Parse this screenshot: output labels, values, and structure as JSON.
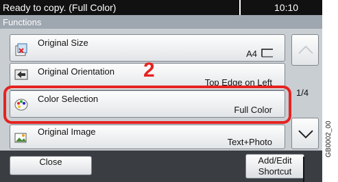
{
  "status": {
    "text": "Ready to copy. (Full Color)",
    "time": "10:10"
  },
  "header": {
    "title": "Functions"
  },
  "items": [
    {
      "label": "Original Size",
      "value": "A4",
      "icon": "original-size-icon"
    },
    {
      "label": "Original Orientation",
      "value": "Top Edge on Left",
      "icon": "orientation-icon"
    },
    {
      "label": "Color Selection",
      "value": "Full Color",
      "icon": "color-palette-icon"
    },
    {
      "label": "Original Image",
      "value": "Text+Photo",
      "icon": "image-quality-icon"
    }
  ],
  "scroll": {
    "page": "1/4"
  },
  "annotation": {
    "step": "2",
    "reference": "GB0002_00"
  },
  "footer": {
    "close": "Close",
    "add_edit_line1": "Add/Edit",
    "add_edit_line2": "Shortcut"
  },
  "colors": {
    "highlight": "#e52321",
    "status_bar": "#111111",
    "panel": "#3a3d42"
  }
}
